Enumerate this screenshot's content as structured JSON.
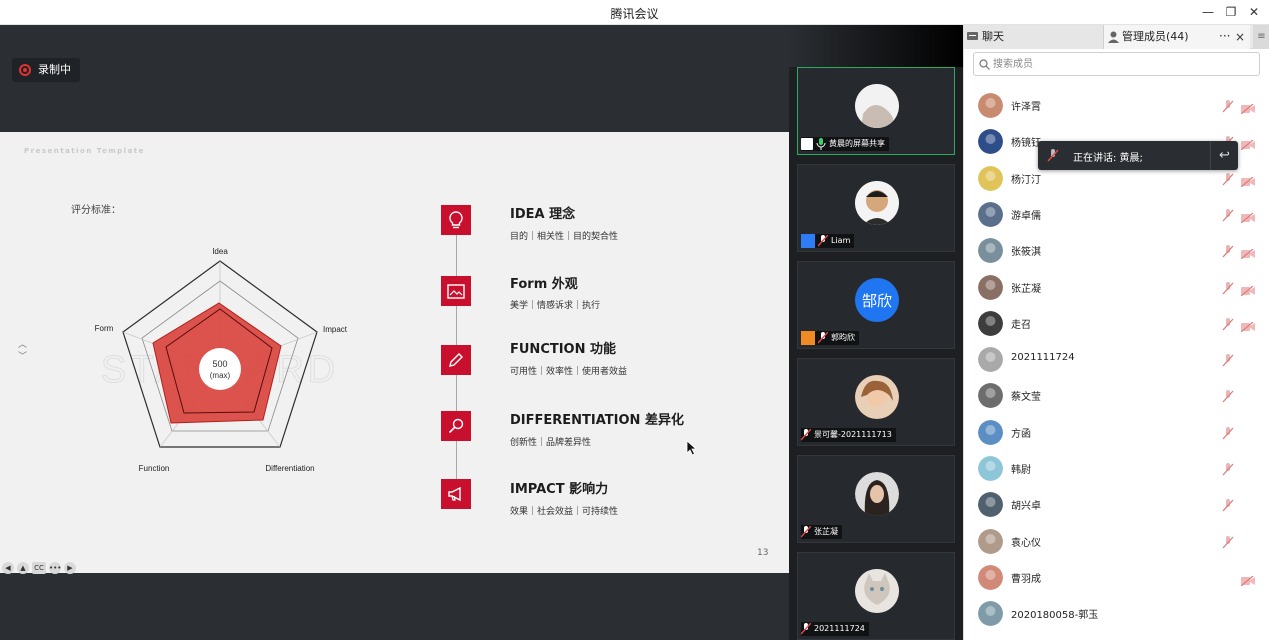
{
  "window": {
    "title": "腾讯会议"
  },
  "recording": {
    "label": "录制中"
  },
  "slide": {
    "template_label": "Presentation Template",
    "criteria_label": "评分标准：",
    "radar": {
      "axes": [
        "Idea",
        "Impact",
        "Differentiation",
        "Function",
        "Form"
      ],
      "center_value": "500",
      "center_note": "(max)",
      "watermark": "STANDARD"
    },
    "timeline": [
      {
        "title": "IDEA 理念",
        "subtitle": "目的｜相关性｜目的契合性",
        "icon": "bulb-icon"
      },
      {
        "title": "Form 外观",
        "subtitle": "美学｜情感诉求｜执行",
        "icon": "image-icon"
      },
      {
        "title": "FUNCTION 功能",
        "subtitle": "可用性｜效率性｜使用者效益",
        "icon": "pen-icon"
      },
      {
        "title": "DIFFERENTIATION 差异化",
        "subtitle": "创新性｜品牌差异性",
        "icon": "magnifier-icon"
      },
      {
        "title": "IMPACT 影响力",
        "subtitle": "效果｜社会效益｜可持续性",
        "icon": "megaphone-icon"
      }
    ],
    "page_number": "13",
    "controls": [
      "◀",
      "▲",
      "CC",
      "•••",
      "▶"
    ]
  },
  "video_tiles": [
    {
      "name": "黄晨的屏幕共享",
      "badge": "screen-share-icon",
      "mic": "on",
      "active": true,
      "avatar_color": "#e6e6e6"
    },
    {
      "name": "Liam",
      "badge": "user-icon",
      "mic": "off",
      "active": false,
      "avatar_color": "#d8b48a"
    },
    {
      "name": "郭昀欣",
      "badge": "user-icon-orange",
      "mic": "off",
      "active": false,
      "avatar_text": "郜欣",
      "avatar_color": "#1f76f0"
    },
    {
      "name": "景可馨-2021111713",
      "badge": "none",
      "mic": "off",
      "active": false,
      "avatar_color": "#b07a56"
    },
    {
      "name": "张芷凝",
      "badge": "none",
      "mic": "off",
      "active": false,
      "avatar_color": "#5c4a44"
    },
    {
      "name": "2021111724",
      "badge": "none",
      "mic": "off",
      "active": false,
      "avatar_color": "#d9d0c8"
    }
  ],
  "sidebar": {
    "tab_chat": "聊天",
    "tab_members": "管理成员(44)",
    "tab_more": "···",
    "tab_close": "×",
    "search_placeholder": "搜索成员",
    "speaking_label": "正在讲话: 黄晨;",
    "members": [
      {
        "name": "许泽霄",
        "mic_off": true,
        "cam_off": true,
        "avatar_color": "#c98b6f"
      },
      {
        "name": "杨镜钰",
        "mic_off": true,
        "cam_off": true,
        "avatar_color": "#2e4e8a"
      },
      {
        "name": "杨汀汀",
        "mic_off": true,
        "cam_off": true,
        "avatar_color": "#e0c45a"
      },
      {
        "name": "游卓儒",
        "mic_off": true,
        "cam_off": true,
        "avatar_color": "#5a6f8c"
      },
      {
        "name": "张筱淇",
        "mic_off": true,
        "cam_off": true,
        "avatar_color": "#7a8f9c"
      },
      {
        "name": "张芷凝",
        "mic_off": true,
        "cam_off": true,
        "avatar_color": "#8a7064"
      },
      {
        "name": "走召",
        "mic_off": true,
        "cam_off": true,
        "avatar_color": "#3d3d3d"
      },
      {
        "name": "2021111724",
        "mic_off": true,
        "cam_off": false,
        "avatar_color": "#a9a9a9"
      },
      {
        "name": "蔡文莹",
        "mic_off": true,
        "cam_off": false,
        "avatar_color": "#6d6d6d"
      },
      {
        "name": "方函",
        "mic_off": true,
        "cam_off": false,
        "avatar_color": "#5b8fc4"
      },
      {
        "name": "韩尉",
        "mic_off": true,
        "cam_off": false,
        "avatar_color": "#8ec6d9"
      },
      {
        "name": "胡兴卓",
        "mic_off": true,
        "cam_off": false,
        "avatar_color": "#51606e"
      },
      {
        "name": "袁心仪",
        "mic_off": true,
        "cam_off": false,
        "avatar_color": "#b09a8a"
      },
      {
        "name": "曹羽成",
        "mic_off": false,
        "cam_off": true,
        "avatar_color": "#d18a78"
      },
      {
        "name": "2020180058-郭玉",
        "mic_off": false,
        "cam_off": false,
        "avatar_color": "#7f9aa8"
      }
    ]
  }
}
